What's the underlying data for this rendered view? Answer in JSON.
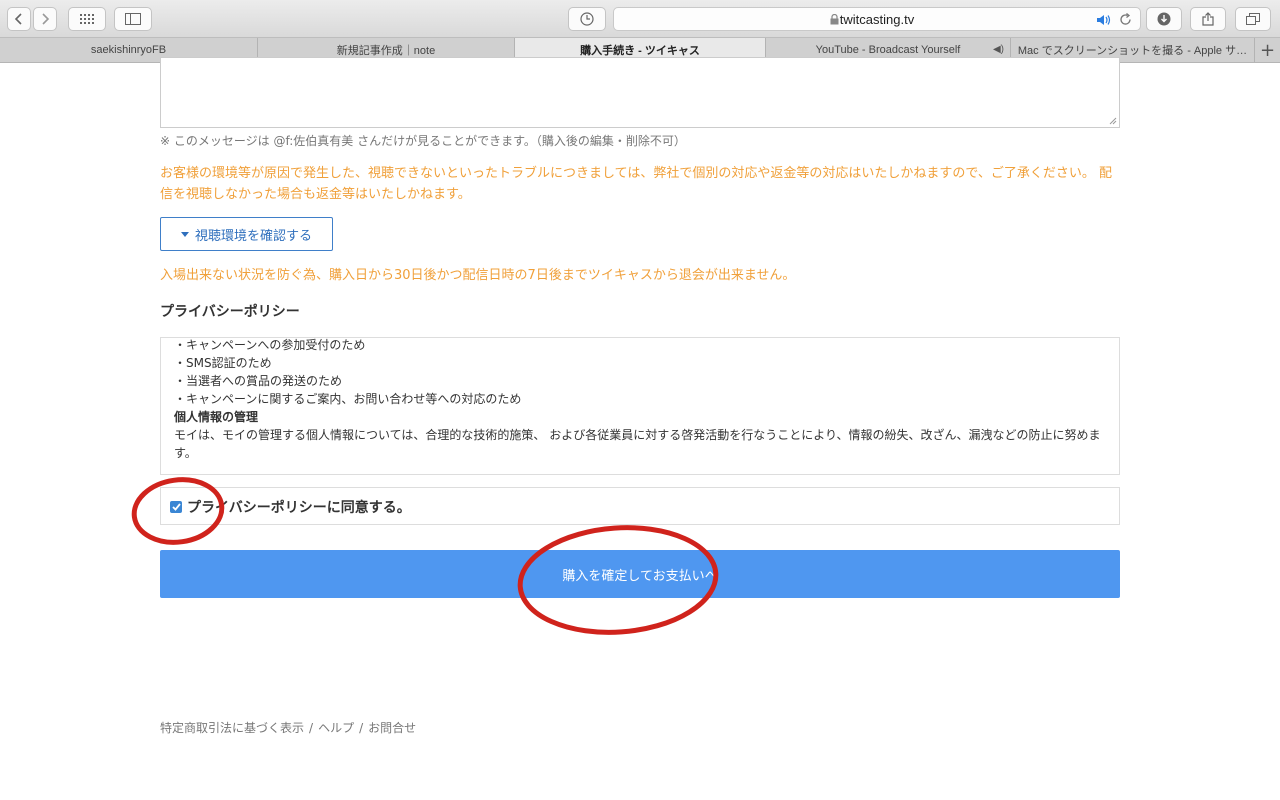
{
  "browser": {
    "url": "twitcasting.tv",
    "tabs": [
      {
        "label": "saekishinryoFB",
        "active": false
      },
      {
        "label": "新規記事作成｜note",
        "active": false
      },
      {
        "label": "購入手続き - ツイキャス",
        "active": true
      },
      {
        "label": "YouTube - Broadcast Yourself",
        "active": false,
        "audio": true
      },
      {
        "label": "Mac でスクリーンショットを撮る - Apple サ…",
        "active": false
      }
    ]
  },
  "page": {
    "message_note": "※ このメッセージは @f:佐伯真有美 さんだけが見ることができます。（購入後の編集・削除不可）",
    "warning": "お客様の環境等が原因で発生した、視聴できないといったトラブルにつきましては、弊社で個別の対応や返金等の対応はいたしかねますので、ご了承ください。 配信を視聴しなかった場合も返金等はいたしかねます。",
    "env_button": "視聴環境を確認する",
    "withdraw_notice": "入場出来ない状況を防ぐ為、購入日から30日後かつ配信日時の7日後までツイキャスから退会が出来ません。",
    "privacy_title": "プライバシーポリシー",
    "privacy_lines": {
      "l0": "・キャンペーンへの参加受付のため",
      "l1": "・SMS認証のため",
      "l2": "・当選者への賞品の発送のため",
      "l3": "・キャンペーンに関するご案内、お問い合わせ等への対応のため",
      "heading": "個人情報の管理",
      "body": "モイは、モイの管理する個人情報については、合理的な技術的施策、 および各従業員に対する啓発活動を行なうことにより、情報の紛失、改ざん、漏洩などの防止に努めます。"
    },
    "agree_label": "プライバシーポリシーに同意する。",
    "agree_checked": true,
    "buy_button": "購入を確定してお支払いへ",
    "footer": {
      "link1": "特定商取引法に基づく表示",
      "link2": "ヘルプ",
      "link3": "お問合せ",
      "sep": "/"
    }
  },
  "colors": {
    "warning_text": "#f0a03a",
    "primary_button": "#4f97f0",
    "outline_button": "#2f6fbd",
    "annotation_red": "#d0231c"
  }
}
